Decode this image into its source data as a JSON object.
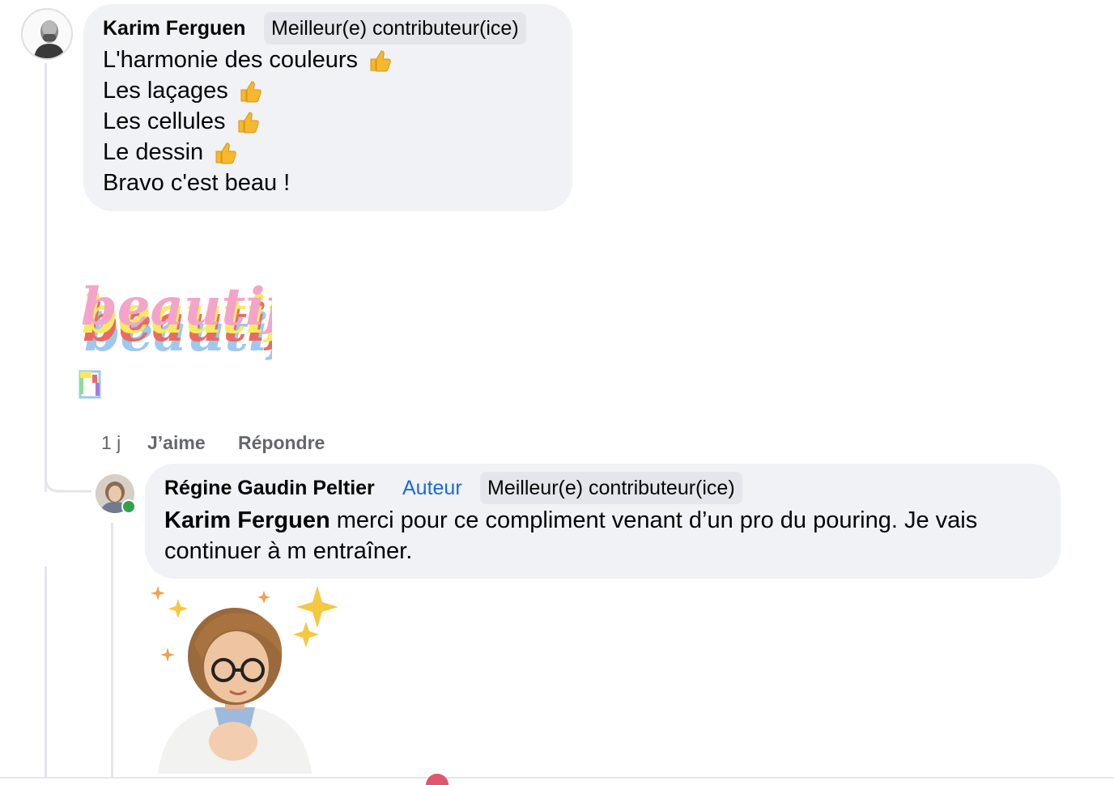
{
  "comment": {
    "author": "Karim Ferguen",
    "badge": "Meilleur(e) contributeur(ice)",
    "lines": [
      "L'harmonie des couleurs",
      "Les laçages",
      "Les cellules",
      "Le dessin",
      "Bravo c'est beau !"
    ],
    "sticker_alt": "beautiful",
    "actions": {
      "time": "1 j",
      "like": "J’aime",
      "reply": "Répondre"
    }
  },
  "reply": {
    "author": "Régine Gaudin Peltier",
    "author_badge": "Auteur",
    "badge": "Meilleur(e) contributeur(ice)",
    "mention": "Karim Ferguen",
    "text": " merci pour ce compliment venant d’un pro du pouring. Je vais continuer à m entraîner.",
    "online": true
  },
  "colors": {
    "bubble": "#f0f2f5",
    "badge_bg": "#e4e6eb",
    "author_badge": "#1b6ad6",
    "secondary_text": "#65676b",
    "online": "#31a24c",
    "thumb": "#f5b82e"
  }
}
